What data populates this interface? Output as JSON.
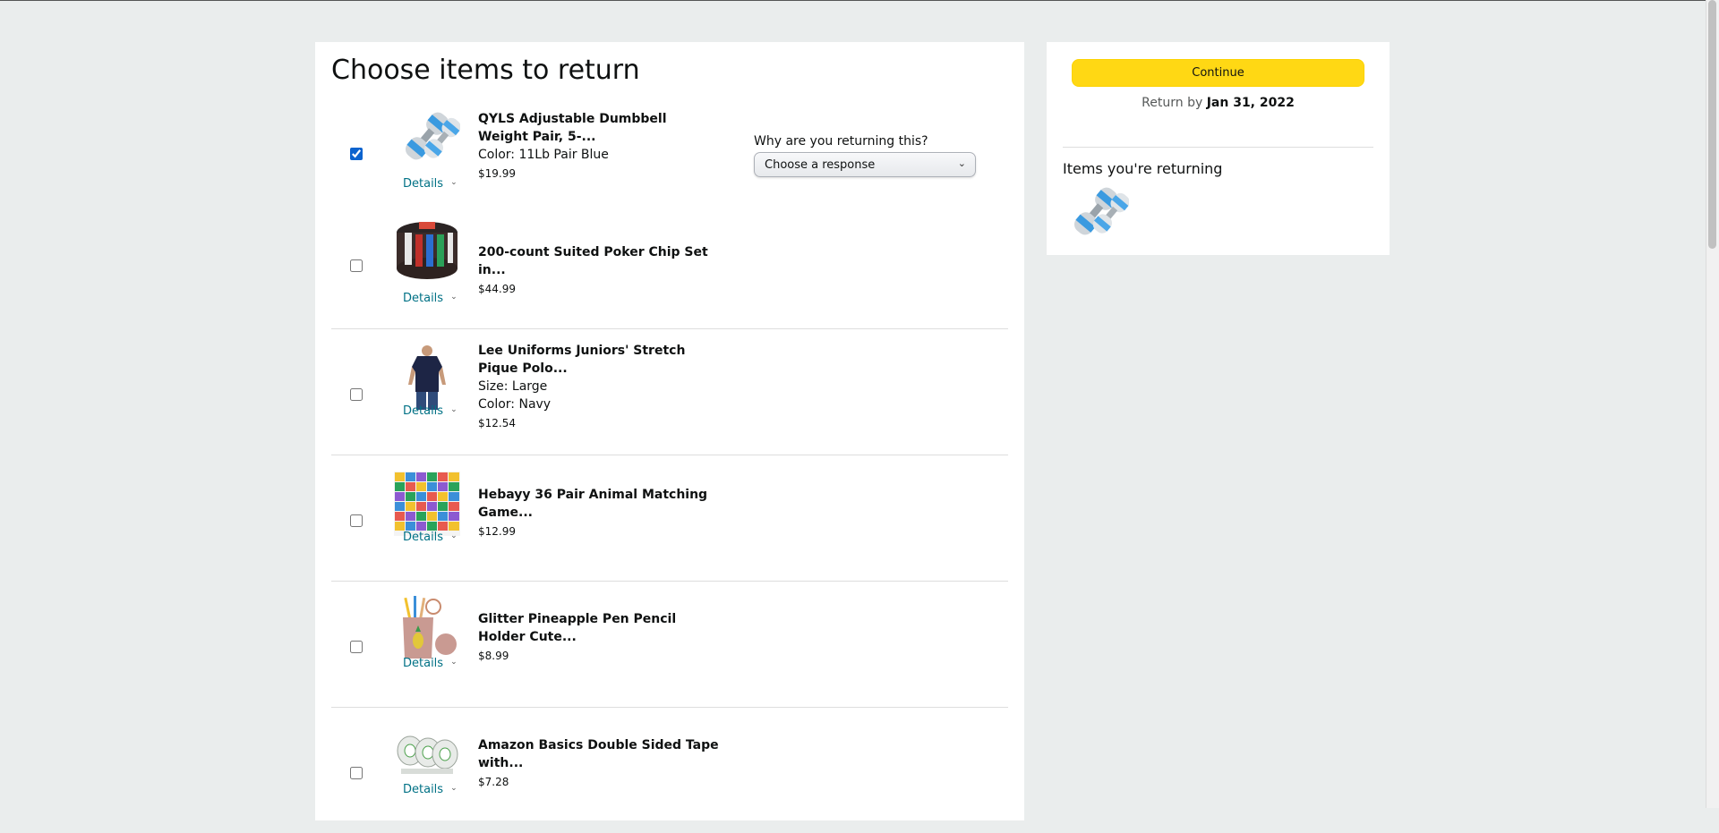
{
  "page": {
    "title": "Choose items to return"
  },
  "items": [
    {
      "title": "QYLS Adjustable Dumbbell Weight Pair, 5-...",
      "attrs": [
        "Color: 11Lb Pair Blue"
      ],
      "price": "$19.99",
      "details": "Details",
      "checked": true,
      "image": "dumbbell-image"
    },
    {
      "title": "200-count Suited Poker Chip Set in...",
      "attrs": [],
      "price": "$44.99",
      "details": "Details",
      "checked": false,
      "image": "poker-chip-image"
    },
    {
      "title": "Lee Uniforms Juniors' Stretch Pique Polo...",
      "attrs": [
        "Size: Large",
        "Color: Navy"
      ],
      "price": "$12.54",
      "details": "Details",
      "checked": false,
      "image": "polo-shirt-image"
    },
    {
      "title": "Hebayy 36 Pair Animal Matching Game...",
      "attrs": [],
      "price": "$12.99",
      "details": "Details",
      "checked": false,
      "image": "matching-game-image"
    },
    {
      "title": "Glitter Pineapple Pen Pencil Holder Cute...",
      "attrs": [],
      "price": "$8.99",
      "details": "Details",
      "checked": false,
      "image": "pencil-holder-image"
    },
    {
      "title": "Amazon Basics Double Sided Tape with...",
      "attrs": [],
      "price": "$7.28",
      "details": "Details",
      "checked": false,
      "image": "tape-image"
    }
  ],
  "reason": {
    "label": "Why are you returning this?",
    "selected": "Choose a response"
  },
  "summary": {
    "continue_label": "Continue",
    "return_by_prefix": "Return by",
    "return_by_date": "Jan 31, 2022",
    "returning_title": "Items you're returning"
  },
  "colors": {
    "accent_button": "#ffd814",
    "link": "#007185",
    "background": "#eaeded"
  },
  "icons": {
    "details_chevron": "chevron-down-icon",
    "select_arrow": "chevron-down-icon"
  }
}
